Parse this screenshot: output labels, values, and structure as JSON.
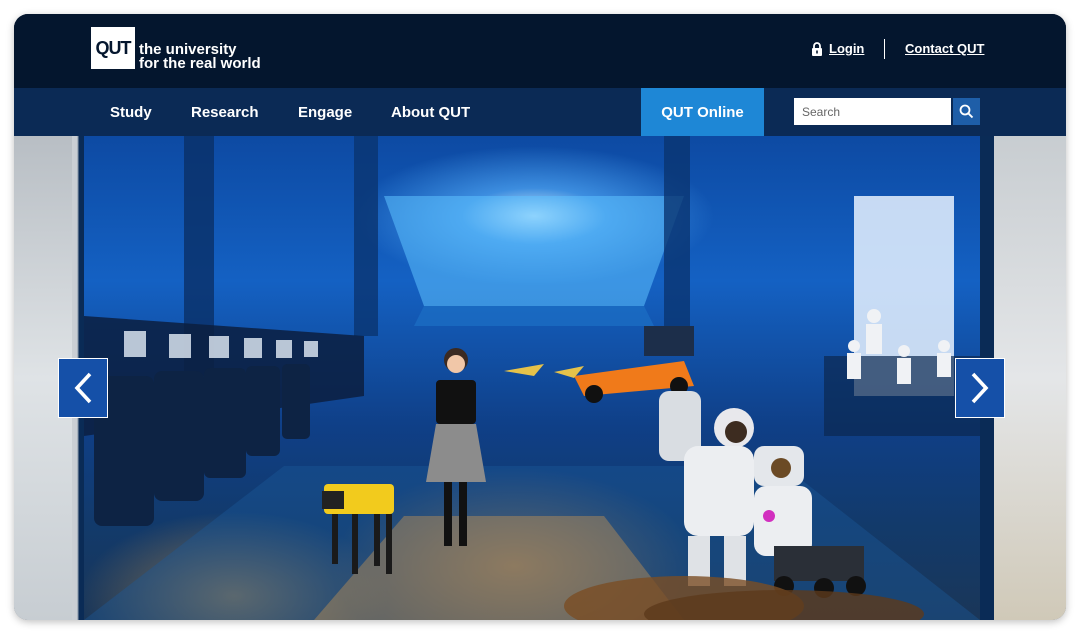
{
  "header": {
    "logo_text": "QUT",
    "tagline_line1": "the university",
    "tagline_line2": "for the real world",
    "login_label": "Login",
    "contact_label": "Contact QUT"
  },
  "nav": {
    "items": [
      {
        "label": "Study"
      },
      {
        "label": "Research"
      },
      {
        "label": "Engage"
      },
      {
        "label": "About QUT"
      }
    ],
    "online_label": "QUT Online",
    "search_placeholder": "Search"
  },
  "hero": {
    "icons": [
      "chevron-left-icon",
      "chevron-right-icon"
    ]
  },
  "colors": {
    "topbar": "#04162e",
    "navbar": "#0b2a55",
    "accent": "#1e87d6",
    "arrow": "#1550a8"
  }
}
